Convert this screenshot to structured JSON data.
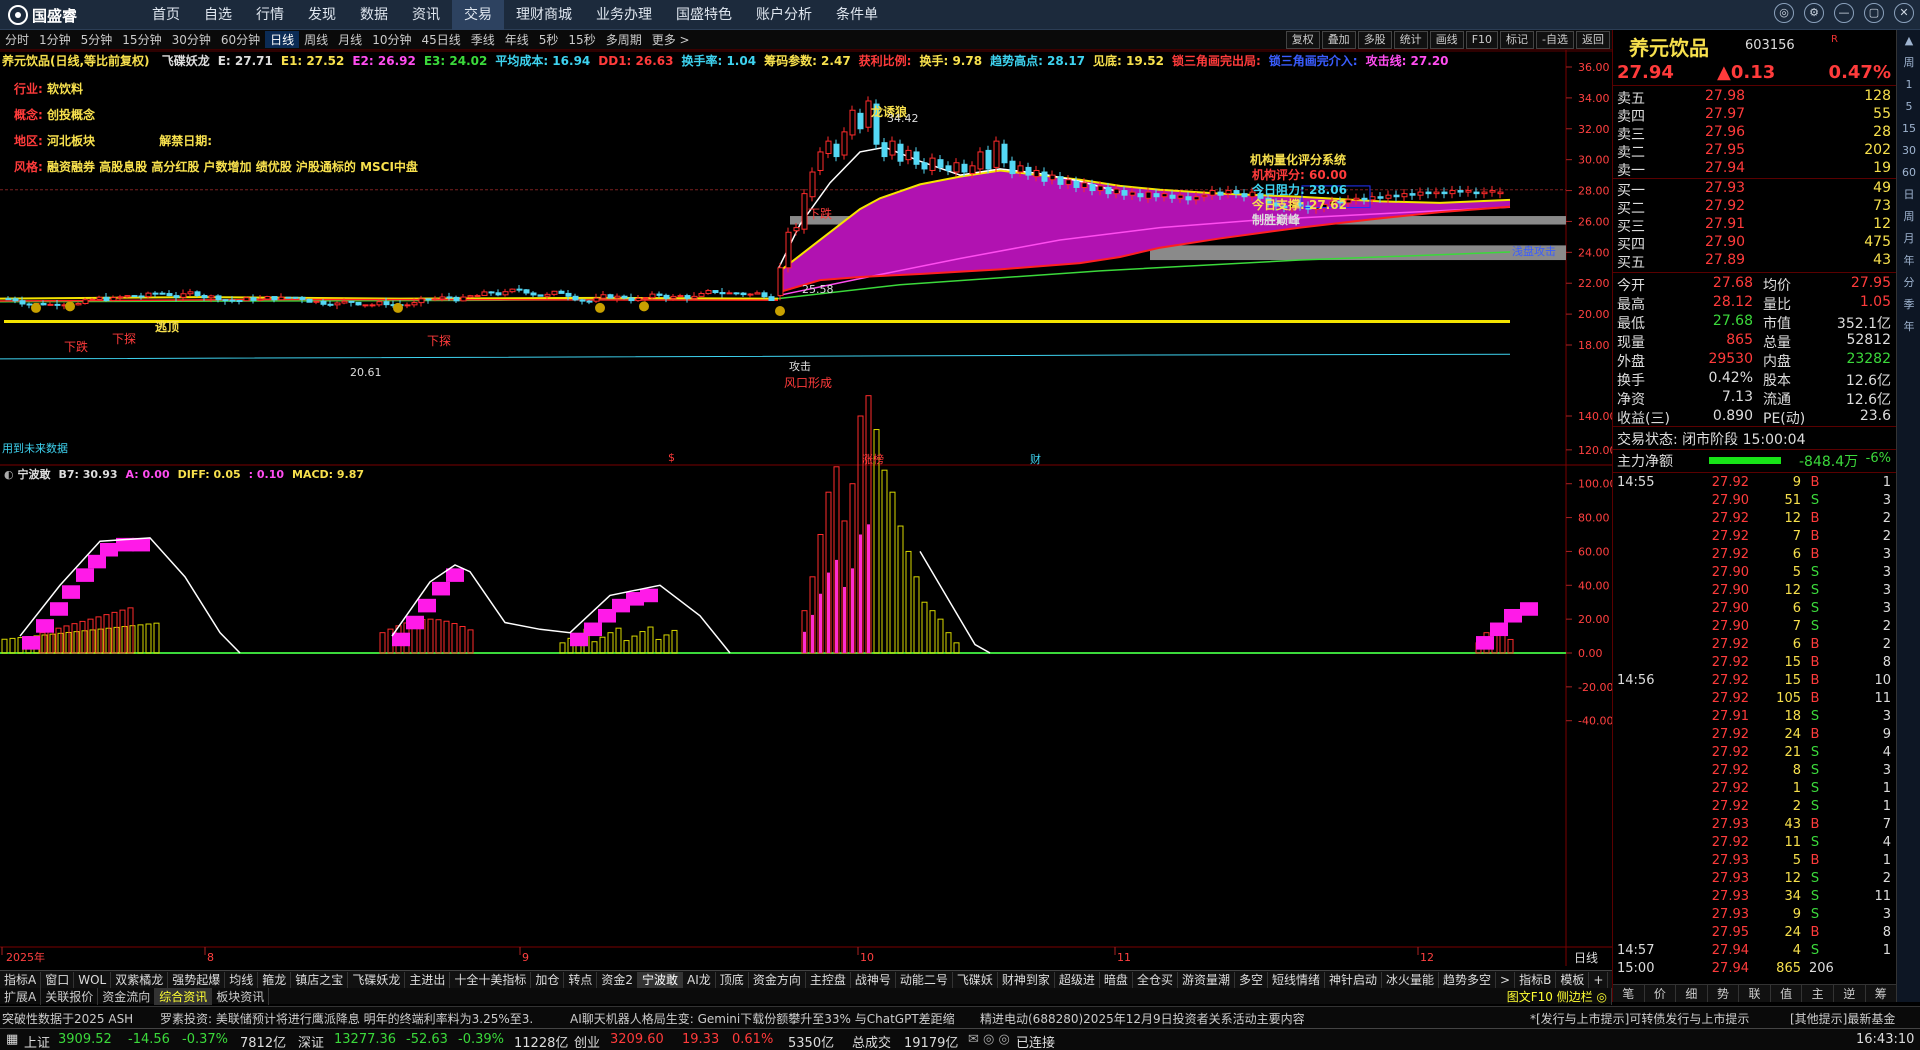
{
  "app": {
    "logo_text": "国盛睿"
  },
  "menu": [
    "首页",
    "自选",
    "行情",
    "发现",
    "数据",
    "资讯",
    "交易",
    "理财商城",
    "业务办理",
    "国盛特色",
    "账户分析",
    "条件单"
  ],
  "menu_active": 6,
  "window_controls": [
    "◎",
    "⚙",
    "—",
    "▢",
    "✕"
  ],
  "periods": [
    "分时",
    "1分钟",
    "5分钟",
    "15分钟",
    "30分钟",
    "60分钟",
    "日线",
    "周线",
    "月线",
    "10分钟",
    "45日线",
    "季线",
    "年线",
    "5秒",
    "15秒",
    "多周期",
    "更多 >"
  ],
  "period_active": 6,
  "right_tools": [
    "复权",
    "叠加",
    "多股",
    "统计",
    "画线",
    "F10",
    "标记",
    "-自选",
    "返回"
  ],
  "header": {
    "name": "养元饮品(日线,等比前复权)",
    "items": [
      {
        "t": "飞碟妖龙",
        "c": "#ddd"
      },
      {
        "t": "E: 27.71",
        "c": "#ddd"
      },
      {
        "t": "E1: 27.52",
        "c": "#f7e04d"
      },
      {
        "t": "E2: 26.92",
        "c": "#ff4df0"
      },
      {
        "t": "E3: 24.02",
        "c": "#3bd93b"
      },
      {
        "t": "平均成本: 16.94",
        "c": "#3ed3f0"
      },
      {
        "t": "DD1: 26.63",
        "c": "#ff3b3b"
      },
      {
        "t": "换手率: 1.04",
        "c": "#3ed3f0"
      },
      {
        "t": "筹码参数: 2.47",
        "c": "#f7e04d"
      },
      {
        "t": "获利比例:",
        "c": "#ff3b3b"
      },
      {
        "t": "换手: 9.78",
        "c": "#f7e04d"
      },
      {
        "t": "趋势高点: 28.17",
        "c": "#3ed3f0"
      },
      {
        "t": "见底: 19.52",
        "c": "#f7e04d"
      },
      {
        "t": "锁三角画完出局:",
        "c": "#ff3b3b"
      },
      {
        "t": "锁三角画完介入:",
        "c": "#3a5dff"
      },
      {
        "t": "攻击线: 27.20",
        "c": "#ff4df0"
      }
    ]
  },
  "info": {
    "industry_label": "行业:",
    "industry": "软饮料",
    "concept_label": "概念:",
    "concept": "创投概念",
    "region_label": "地区:",
    "region": "河北板块",
    "unban_label": "解禁日期:",
    "style_label": "风格:",
    "style": "融资融券 高股息股 高分红股 户数增加 绩优股 沪股通标的 MSCI中盘"
  },
  "score": {
    "title": "机构量化评分系统",
    "l1": "机构评分: 60.00",
    "l2": "今日阻力: 28.06",
    "l3": "今日支撑: 27.62",
    "l4": "制胜巅峰"
  },
  "annotations": {
    "dragon": "龙诱狼",
    "dragon_price": "34.42",
    "xia_die": "下跌",
    "xia_die2": "下探",
    "tao_shou": "逃顶",
    "low_mark": "20.61",
    "wind": "风口形成",
    "rise_break": "25.58",
    "attack": "攻击",
    "chip": "筹码攻击",
    "cue": "浅盘攻击",
    "future": "用到未来数据",
    "marks_row": [
      "$",
      "涨榜",
      "财"
    ]
  },
  "chart_data": [
    {
      "type": "line",
      "title": "养元饮品(日线,等比前复权)",
      "ylim": [
        17,
        37
      ],
      "y_ticks": [
        18,
        20,
        22,
        24,
        26,
        28,
        30,
        32,
        34,
        36
      ],
      "x_ticks": [
        "2025年",
        "8",
        "9",
        "10",
        "11",
        "12"
      ],
      "series": [
        {
          "name": "E1",
          "values": [
            21.0,
            21.1,
            21.2,
            21.5,
            23.5,
            26.8,
            27.2,
            27.5,
            27.4,
            27.3,
            27.52
          ]
        },
        {
          "name": "E2",
          "values": [
            20.9,
            21.0,
            21.1,
            21.3,
            22.0,
            24.0,
            25.6,
            26.3,
            26.6,
            26.8,
            26.92
          ]
        },
        {
          "name": "E3",
          "values": [
            20.8,
            20.9,
            21.0,
            21.1,
            21.4,
            22.2,
            22.9,
            23.4,
            23.7,
            23.9,
            24.02
          ]
        }
      ],
      "key_values": {
        "high": 34.42,
        "low": 20.61,
        "close": 27.94
      }
    },
    {
      "type": "bar",
      "title": "宁波敢",
      "ylim": [
        -50,
        160
      ],
      "y_ticks": [
        140,
        120,
        100,
        80,
        60,
        40,
        20,
        0,
        -20,
        -40
      ],
      "header_values": {
        "B7": "30.93",
        "A": "0.00",
        "DIFF": "0.05",
        "DEA": "0.10",
        "MACD": "9.87"
      }
    }
  ],
  "indicator_header": [
    {
      "t": "宁波敢",
      "c": "#ddd"
    },
    {
      "t": "B7: 30.93",
      "c": "#ddd"
    },
    {
      "t": "A: 0.00",
      "c": "#ff4df0"
    },
    {
      "t": "DIFF: 0.05",
      "c": "#f7e04d"
    },
    {
      "t": ": 0.10",
      "c": "#ff4df0"
    },
    {
      "t": "MACD: 9.87",
      "c": "#f7e04d"
    }
  ],
  "quote": {
    "name": "养元饮品",
    "code": "603156",
    "flag": "R",
    "price": "27.94",
    "chg": "▲0.13",
    "pct": "0.47%",
    "asks": [
      [
        "卖五",
        "27.98",
        "128"
      ],
      [
        "卖四",
        "27.97",
        "55"
      ],
      [
        "卖三",
        "27.96",
        "28"
      ],
      [
        "卖二",
        "27.95",
        "202"
      ],
      [
        "卖一",
        "27.94",
        "19"
      ]
    ],
    "bids": [
      [
        "买一",
        "27.93",
        "49"
      ],
      [
        "买二",
        "27.92",
        "73"
      ],
      [
        "买三",
        "27.91",
        "12"
      ],
      [
        "买四",
        "27.90",
        "475"
      ],
      [
        "买五",
        "27.89",
        "43"
      ]
    ],
    "stats": [
      [
        "今开",
        "27.68",
        "均价",
        "27.95"
      ],
      [
        "最高",
        "28.12",
        "量比",
        "1.05"
      ],
      [
        "最低",
        "27.68",
        "市值",
        "352.1亿"
      ],
      [
        "现量",
        "865",
        "总量",
        "52812"
      ],
      [
        "外盘",
        "29530",
        "内盘",
        "23282"
      ],
      [
        "换手",
        "0.42%",
        "股本",
        "12.6亿"
      ],
      [
        "净资",
        "7.13",
        "流通",
        "12.6亿"
      ],
      [
        "收益(三)",
        "0.890",
        "PE(动)",
        "23.6"
      ]
    ],
    "trade_state": "交易状态: 闭市阶段 15:00:04",
    "netflow_label": "主力净额",
    "netflow": "-848.4万",
    "netflow_pct": "-6%"
  },
  "ticks": [
    [
      "14:55",
      "27.92",
      "9",
      "B",
      "1"
    ],
    [
      "",
      "27.90",
      "51",
      "S",
      "3"
    ],
    [
      "",
      "27.92",
      "12",
      "B",
      "2"
    ],
    [
      "",
      "27.92",
      "7",
      "B",
      "2"
    ],
    [
      "",
      "27.92",
      "6",
      "B",
      "3"
    ],
    [
      "",
      "27.90",
      "5",
      "S",
      "3"
    ],
    [
      "",
      "27.90",
      "12",
      "S",
      "3"
    ],
    [
      "",
      "27.90",
      "6",
      "S",
      "3"
    ],
    [
      "",
      "27.90",
      "7",
      "S",
      "2"
    ],
    [
      "",
      "27.92",
      "6",
      "B",
      "2"
    ],
    [
      "",
      "27.92",
      "15",
      "B",
      "8"
    ],
    [
      "14:56",
      "27.92",
      "15",
      "B",
      "10"
    ],
    [
      "",
      "27.92",
      "105",
      "B",
      "11"
    ],
    [
      "",
      "27.91",
      "18",
      "S",
      "3"
    ],
    [
      "",
      "27.92",
      "24",
      "B",
      "9"
    ],
    [
      "",
      "27.92",
      "21",
      "S",
      "4"
    ],
    [
      "",
      "27.92",
      "8",
      "S",
      "3"
    ],
    [
      "",
      "27.92",
      "1",
      "S",
      "1"
    ],
    [
      "",
      "27.92",
      "2",
      "S",
      "1"
    ],
    [
      "",
      "27.93",
      "43",
      "B",
      "7"
    ],
    [
      "",
      "27.92",
      "11",
      "S",
      "4"
    ],
    [
      "",
      "27.93",
      "5",
      "B",
      "1"
    ],
    [
      "",
      "27.93",
      "12",
      "S",
      "2"
    ],
    [
      "",
      "27.93",
      "34",
      "S",
      "11"
    ],
    [
      "",
      "27.93",
      "9",
      "S",
      "3"
    ],
    [
      "",
      "27.95",
      "24",
      "B",
      "8"
    ],
    [
      "14:57",
      "27.94",
      "4",
      "S",
      "1"
    ],
    [
      "15:00",
      "27.94",
      "865",
      "206",
      ""
    ]
  ],
  "right_tabs": [
    "笔",
    "价",
    "细",
    "势",
    "联",
    "值",
    "主",
    "逆",
    "筹"
  ],
  "sidebar": [
    "▲",
    "周",
    "1",
    "5",
    "15",
    "30",
    "60",
    "日",
    "周",
    "月",
    "年",
    "分",
    "季",
    "年"
  ],
  "bottom_tabs": [
    "指标A",
    "窗口",
    "WOL",
    "双紫橘龙",
    "强势起爆",
    "均线",
    "箍龙",
    "镇店之宝",
    "飞碟妖龙",
    "主进出",
    "十全十美指标",
    "加仓",
    "转点",
    "资金2",
    "宁波敢",
    "AI龙",
    "顶底",
    "资金方向",
    "主控盘",
    "战神号",
    "动能二号",
    "飞碟妖",
    "财神到家",
    "超级进",
    "暗盘",
    "全仓买",
    "游资量潮",
    "多空",
    "短线情绪",
    "神针启动",
    "冰火量能",
    "趋势多空",
    ">",
    "指标B",
    "模板",
    "+",
    "-"
  ],
  "bottom_tabs_active": 14,
  "bottom_tabs2": [
    "扩展A",
    "关联报价",
    "资金流向",
    "综合资讯",
    "板块资讯"
  ],
  "bottom_tabs2_active": 3,
  "bottom_tabs2_right": "图文F10 侧边栏 ◎",
  "news": [
    "突破性数据于2025 ASH",
    "罗素投资: 美联储预计将进行鹰派降息 明年的终端利率料为3.25%至3.",
    "AI聊天机器人格局生变: Gemini下载份额攀升至33% 与ChatGPT差距缩",
    "精进电动(688280)2025年12月9日投资者关系活动主要内容",
    "*[发行与上市提示]可转债发行与上市提示",
    "[其他提示]最新基金"
  ],
  "status": {
    "sh_label": "上证",
    "sh": "3909.52",
    "sh_chg": "-14.56",
    "sh_pct": "-0.37%",
    "sh_amt": "7812亿",
    "sz_label": "深证",
    "sz": "13277.36",
    "sz_chg": "-52.63",
    "sz_pct": "-0.39%",
    "sz_amt": "11228亿",
    "cy_label": "创业",
    "cy": "3209.60",
    "cy_chg": "19.33",
    "cy_pct": "0.61%",
    "cy_amt": "5350亿",
    "total_label": "总成交",
    "total": "19179亿",
    "conn": "已连接",
    "time": "16:43:10"
  }
}
